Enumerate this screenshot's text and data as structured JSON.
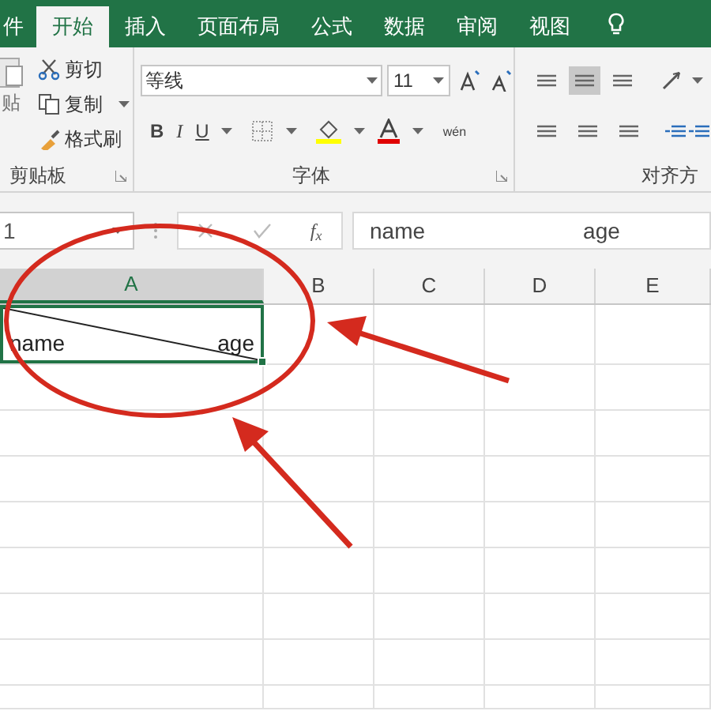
{
  "tabs": [
    {
      "label": "件",
      "selected": false
    },
    {
      "label": "开始",
      "selected": true
    },
    {
      "label": "插入",
      "selected": false
    },
    {
      "label": "页面布局",
      "selected": false
    },
    {
      "label": "公式",
      "selected": false
    },
    {
      "label": "数据",
      "selected": false
    },
    {
      "label": "审阅",
      "selected": false
    },
    {
      "label": "视图",
      "selected": false
    }
  ],
  "clipboard": {
    "paste_label": "贴",
    "items": [
      {
        "label": "剪切",
        "caret": false
      },
      {
        "label": "复制",
        "caret": true
      },
      {
        "label": "格式刷",
        "caret": false
      }
    ],
    "group_label": "剪贴板"
  },
  "font": {
    "font_name": "等线",
    "font_size": "11",
    "bold": "B",
    "italic": "I",
    "underline": "U",
    "phonetic": "wén",
    "group_label": "字体"
  },
  "alignment": {
    "group_label": "对齐方"
  },
  "formula_bar": {
    "name_box": "1",
    "function_label": "f$_{x}$",
    "texts": [
      "name",
      "age"
    ]
  },
  "columns": [
    {
      "label": "A",
      "selected": true
    },
    {
      "label": "B",
      "selected": false
    },
    {
      "label": "C",
      "selected": false
    },
    {
      "label": "D",
      "selected": false
    },
    {
      "label": "E",
      "selected": false
    }
  ],
  "cell": {
    "texts": [
      "name",
      "age"
    ],
    "selected": true,
    "diagonal": true
  }
}
